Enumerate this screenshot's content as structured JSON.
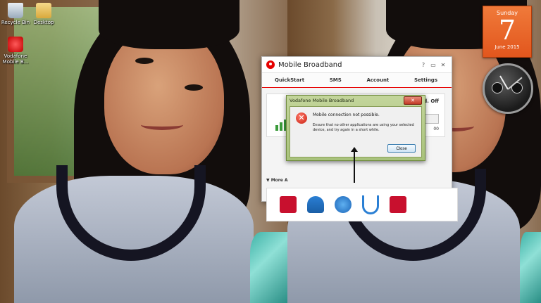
{
  "desktop": {
    "icons": [
      {
        "label": "Recycle Bin"
      },
      {
        "label": "Desktop"
      },
      {
        "label": "Vodafone Mobile B..."
      }
    ]
  },
  "calendar": {
    "weekday": "Sunday",
    "day": "7",
    "month_year": "June 2015"
  },
  "mobile_broadband": {
    "title": "Mobile Broadband",
    "controls": [
      "?",
      "▭",
      "✕"
    ],
    "tabs": [
      "QuickStart",
      "SMS",
      "Account",
      "Settings"
    ],
    "status_fragment": "d. Off",
    "value_fragment": "00",
    "more_label": "More A"
  },
  "error_dialog": {
    "title": "Vodafone Mobile Broadband",
    "close_glyph": "✕",
    "message": "Mobile connection not possible.",
    "detail": "Ensure that no other applications are using your selected device, and try again in a short while.",
    "close_button": "Close"
  },
  "colors": {
    "brand": "#e60000",
    "calendar": "#e2561d",
    "dialog": "#a8c27b"
  }
}
